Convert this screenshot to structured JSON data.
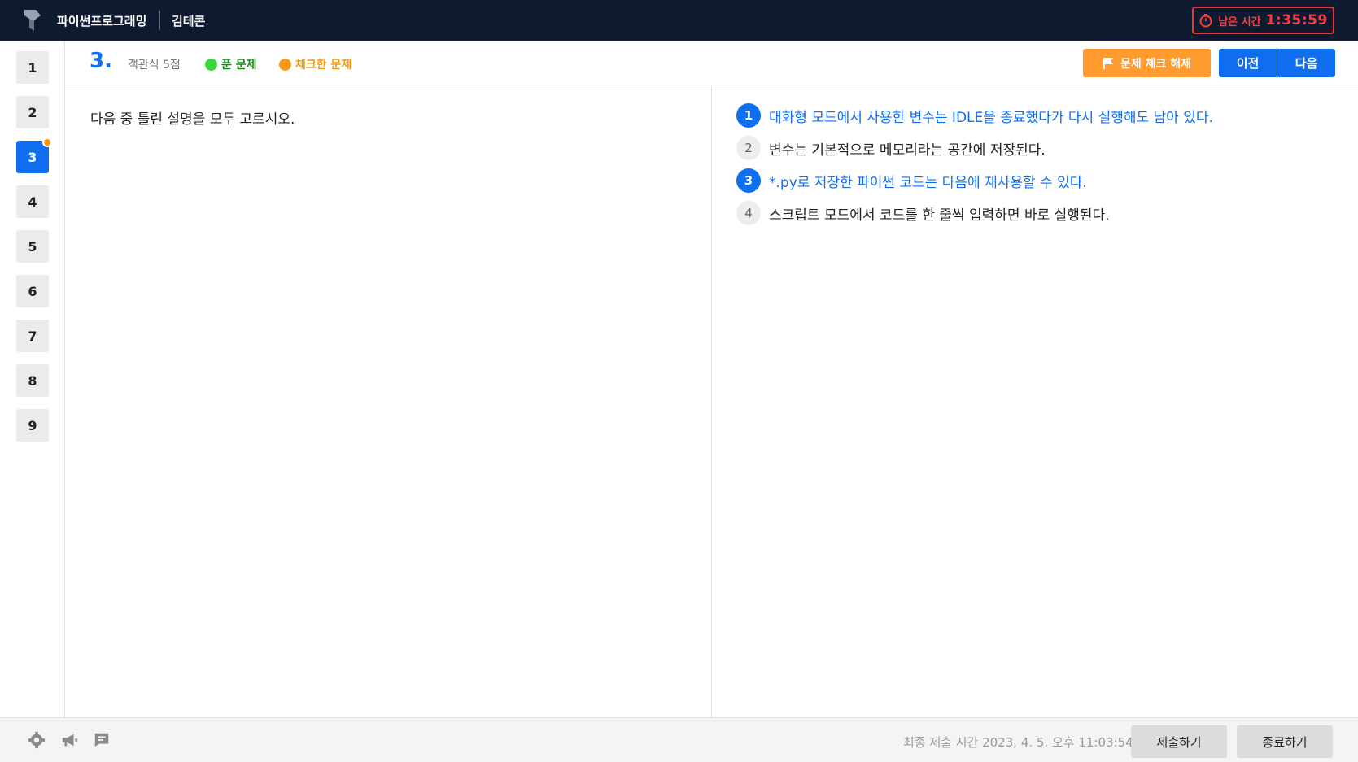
{
  "header": {
    "app_title": "파이썬프로그래밍",
    "user_name": "김테콘",
    "timer": {
      "label": "남은 시간",
      "value": "1:35:59"
    }
  },
  "sidebar": {
    "questions": [
      "1",
      "2",
      "3",
      "4",
      "5",
      "6",
      "7",
      "8",
      "9"
    ],
    "active": "3",
    "checked": [
      "3"
    ]
  },
  "question": {
    "number": "3.",
    "type_score": "객관식 5점",
    "legend_solved": "푼 문제",
    "legend_checked": "체크한 문제",
    "text": "다음 중 틀린 설명을 모두 고르시오.",
    "choices": [
      {
        "num": "1",
        "text": "대화형 모드에서 사용한 변수는 IDLE을 종료했다가 다시 실행해도 남아 있다.",
        "selected": true
      },
      {
        "num": "2",
        "text": "변수는 기본적으로 메모리라는 공간에 저장된다.",
        "selected": false
      },
      {
        "num": "3",
        "text": "*.py로 저장한 파이썬 코드는 다음에 재사용할 수 있다.",
        "selected": true
      },
      {
        "num": "4",
        "text": "스크립트 모드에서 코드를 한 줄씩 입력하면 바로 실행된다.",
        "selected": false
      }
    ]
  },
  "toolbar": {
    "uncheck_label": "문제 체크 해제",
    "prev_label": "이전",
    "next_label": "다음"
  },
  "footer": {
    "final_submit_time": "최종 제출 시간 2023. 4. 5. 오후 11:03:54",
    "submit_label": "제출하기",
    "end_label": "종료하기"
  },
  "colors": {
    "topbar": "#0e1a30",
    "accent": "#0f6ef0",
    "check_orange": "#ff9b2f",
    "solved_green": "#3bd63b",
    "timer_red": "#e53935"
  }
}
